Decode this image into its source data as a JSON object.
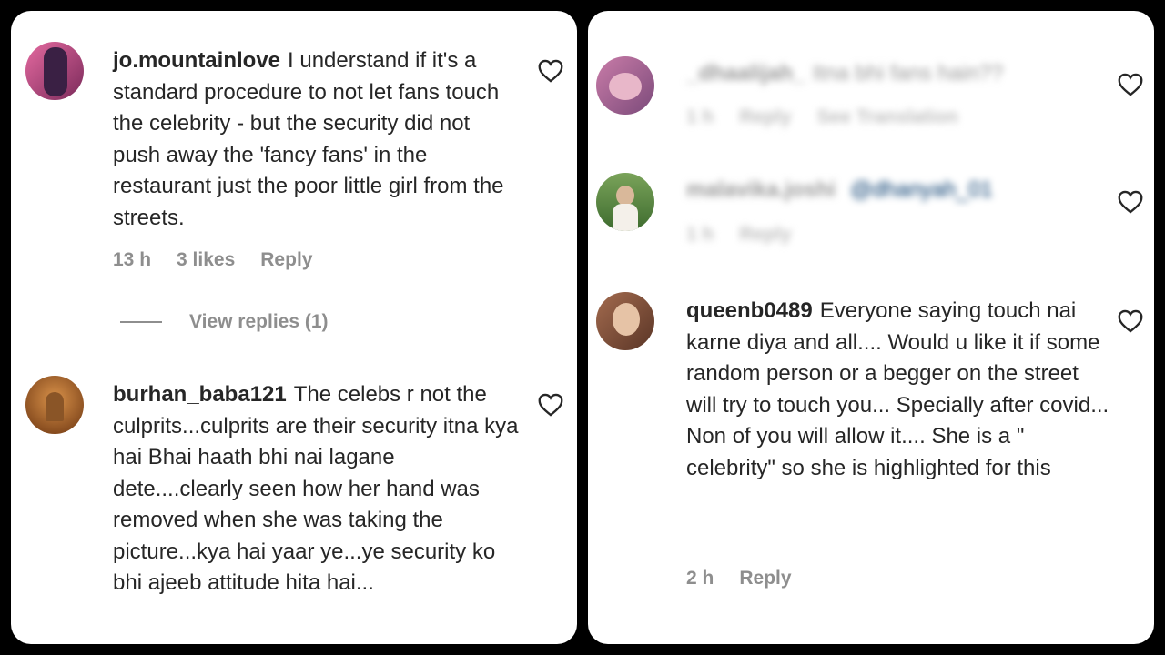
{
  "left": {
    "comments": [
      {
        "username": "jo.mountainlove",
        "text": "I understand if it's a standard procedure to not let fans touch the celebrity - but the security did not push away the 'fancy fans' in the restaurant just the poor little girl from the streets.",
        "time": "13 h",
        "likes": "3 likes",
        "reply": "Reply",
        "view_replies": "View replies (1)"
      },
      {
        "username": "burhan_baba121",
        "text": "The celebs r not the culprits...culprits are their security itna kya hai Bhai haath bhi nai lagane dete....clearly seen how her hand was removed when she was taking the picture...kya hai yaar ye...ye security ko bhi ajeeb attitude hita hai..."
      }
    ]
  },
  "right": {
    "comments": [
      {
        "username": "_dhaalijah_",
        "text": "Itna bhi fans hain??",
        "time": "1 h",
        "reply": "Reply",
        "translation": "See Translation"
      },
      {
        "username": "malavika.joshi",
        "mention": "@dhanyah_01",
        "time": "1 h",
        "reply": "Reply"
      },
      {
        "username": "queenb0489",
        "text": "Everyone saying touch nai karne diya and all.... Would u like it if some random person or a begger on the street will try to touch you... Specially after covid... Non of you will allow it.... She is a \" celebrity\" so she is highlighted for this",
        "time": "2 h",
        "reply": "Reply"
      }
    ]
  },
  "colors": {
    "background": "#000000",
    "panel": "#ffffff",
    "text": "#262626",
    "muted": "#8e8e8e",
    "mention": "#00376b"
  },
  "icons": {
    "like": "heart-outline-icon"
  }
}
